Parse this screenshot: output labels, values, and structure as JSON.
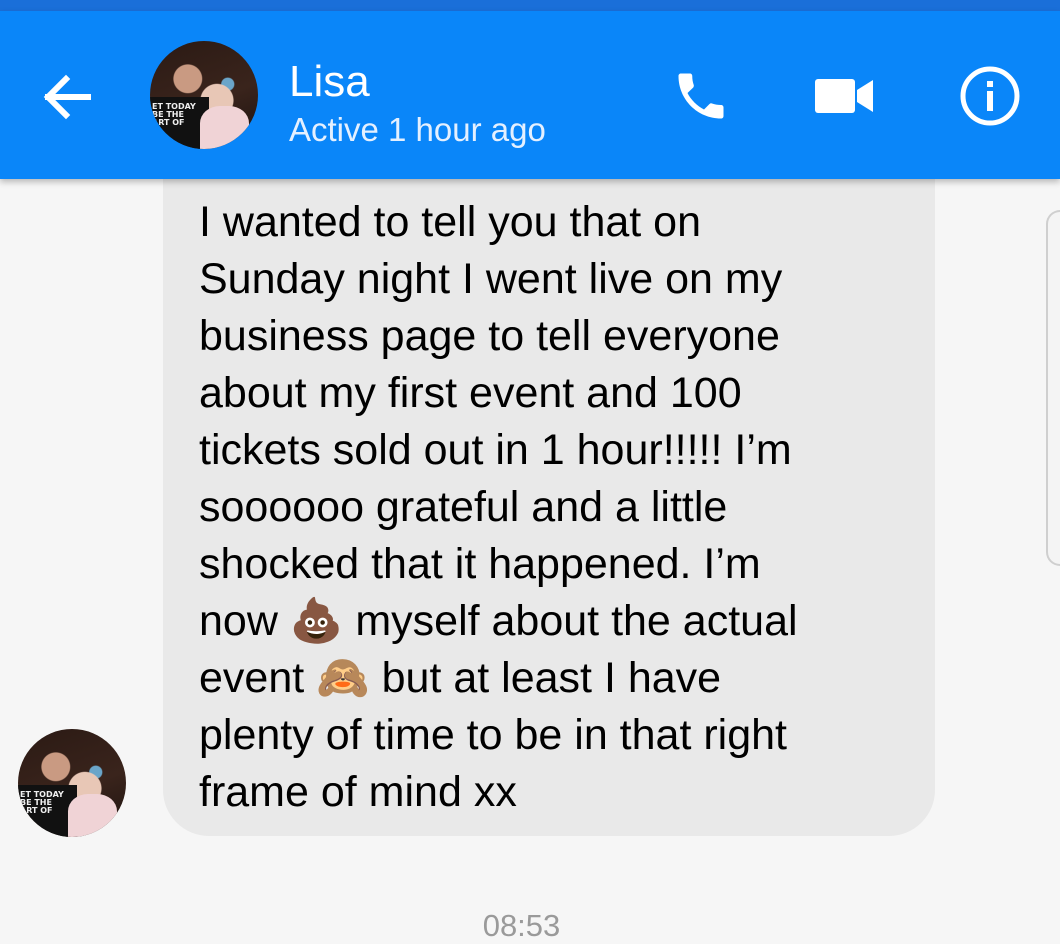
{
  "header": {
    "contact_name": "Lisa",
    "status": "Active 1 hour ago",
    "back_icon": "arrow-left-icon",
    "call_icon": "phone-icon",
    "video_icon": "video-camera-icon",
    "info_icon": "info-icon"
  },
  "avatar_shirt_text": "ET TODAY\nBE THE\nART OF",
  "message": {
    "part1": "I wanted to tell you that on\nSunday night I went live on my\nbusiness page to tell everyone\nabout my first event and 100\ntickets sold out in 1 hour!!!!! I’m\nsoooooo grateful and a little\nshocked that it happened. I’m\nnow ",
    "emoji1": "💩",
    "part2": " myself about the actual\nevent ",
    "emoji2": "🙈",
    "part3": " but at least I have\nplenty of time to be in that right\nframe of mind xx"
  },
  "timestamp": "08:53",
  "colors": {
    "header": "#0a86f9",
    "bubble": "#e9e9e9",
    "background": "#f6f6f6"
  }
}
